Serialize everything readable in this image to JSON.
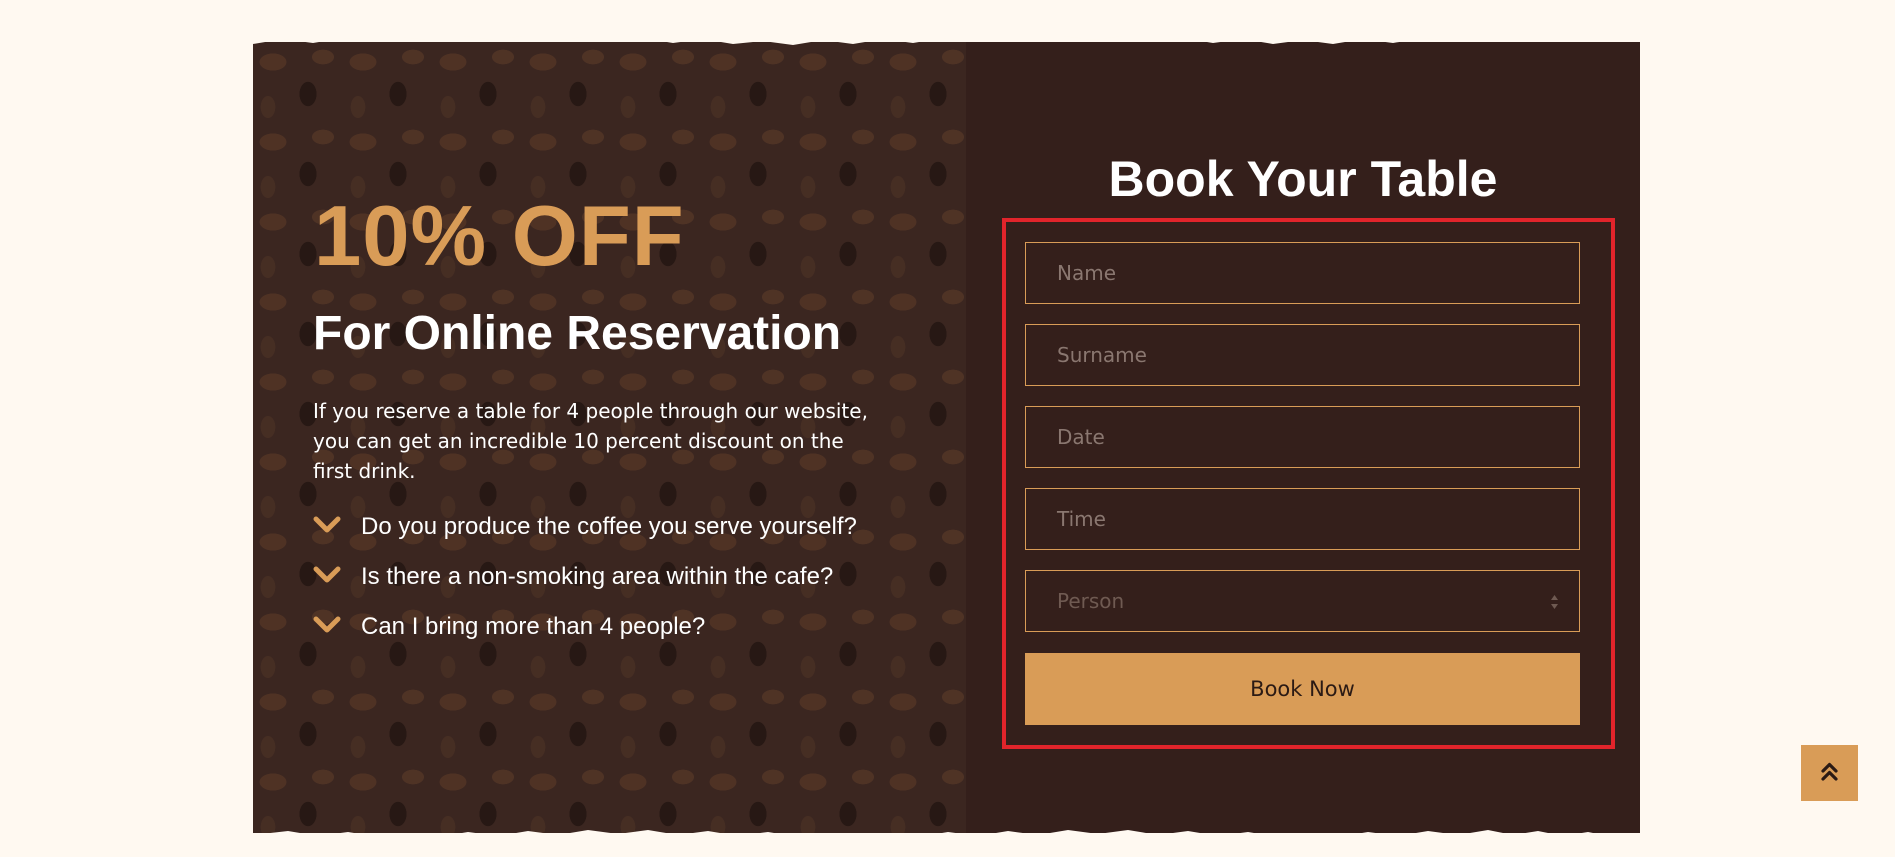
{
  "offer": {
    "title": "10% OFF",
    "subtitle": "For Online Reservation",
    "description": "If you reserve a table for 4 people through our website, you can get an incredible 10 percent discount on the first drink."
  },
  "faq": {
    "items": [
      {
        "label": "Do you produce the coffee you serve yourself?"
      },
      {
        "label": "Is there a non-smoking area within the cafe?"
      },
      {
        "label": "Can I bring more than 4 people?"
      }
    ]
  },
  "booking": {
    "title": "Book Your Table",
    "fields": {
      "name": "Name",
      "surname": "Surname",
      "date": "Date",
      "time": "Time",
      "person": "Person"
    },
    "submit_label": "Book Now"
  },
  "icons": {
    "faq_chevron": "chevron-down-icon",
    "scroll_top": "double-chevron-up-icon"
  },
  "colors": {
    "accent": "#d99c57",
    "background": "#fff9f1",
    "panel_dark": "#341f1b",
    "highlight_outline": "#e1242b"
  }
}
